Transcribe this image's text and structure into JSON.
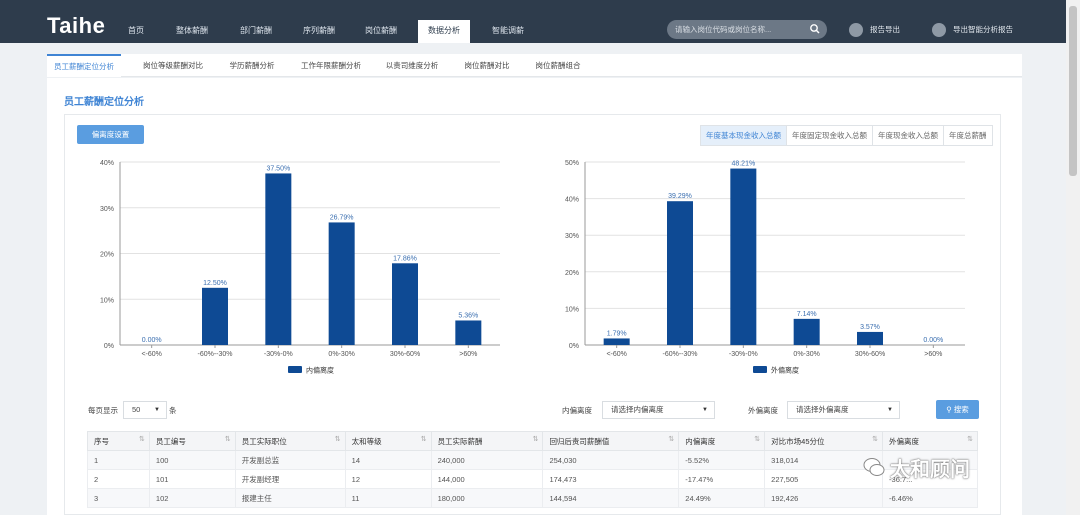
{
  "app": {
    "logo": "Taihe"
  },
  "nav": {
    "items": [
      "首页",
      "整体薪酬",
      "部门薪酬",
      "序列薪酬",
      "岗位薪酬",
      "数据分析",
      "智能调薪"
    ],
    "active_index": 5
  },
  "search": {
    "placeholder": "请输入岗位代码或岗位名称..."
  },
  "tools": {
    "export_report": "报告导出",
    "export_smart": "导出智能分析报告"
  },
  "subtabs": {
    "items": [
      "员工薪酬定位分析",
      "岗位等级薪酬对比",
      "学历薪酬分析",
      "工作年限薪酬分析",
      "以责司维度分析",
      "岗位薪酬对比",
      "岗位薪酬组合"
    ],
    "active_index": 0
  },
  "page": {
    "title": "员工薪酬定位分析"
  },
  "deviation_button": "偏离度设置",
  "basis_tabs": {
    "items": [
      "年度基本现金收入总额",
      "年度固定现金收入总额",
      "年度现金收入总额",
      "年度总薪酬"
    ],
    "active_index": 0
  },
  "chart_data": [
    {
      "type": "bar",
      "categories": [
        "<-60%",
        "-60%--30%",
        "-30%-0%",
        "0%-30%",
        "30%-60%",
        ">60%"
      ],
      "series": [
        {
          "name": "内偏离度",
          "values": [
            0.0,
            12.5,
            37.5,
            26.79,
            17.86,
            5.36
          ]
        }
      ],
      "data_labels": [
        "0.00%",
        "12.50%",
        "37.50%",
        "26.79%",
        "17.86%",
        "5.36%"
      ],
      "yticks": [
        "0%",
        "10%",
        "20%",
        "30%",
        "40%"
      ],
      "ylim": [
        0,
        40
      ],
      "legend": "bottom-center",
      "grid": true,
      "bar_color": "#0e4a94"
    },
    {
      "type": "bar",
      "categories": [
        "<-60%",
        "-60%--30%",
        "-30%-0%",
        "0%-30%",
        "30%-60%",
        ">60%"
      ],
      "series": [
        {
          "name": "外偏离度",
          "values": [
            1.79,
            39.29,
            48.21,
            7.14,
            3.57,
            0.0
          ]
        }
      ],
      "data_labels": [
        "1.79%",
        "39.29%",
        "48.21%",
        "7.14%",
        "3.57%",
        "0.00%"
      ],
      "yticks": [
        "0%",
        "10%",
        "20%",
        "30%",
        "40%",
        "50%"
      ],
      "ylim": [
        0,
        50
      ],
      "legend": "bottom-center",
      "grid": true,
      "bar_color": "#0e4a94"
    }
  ],
  "filters": {
    "page_size_label": "每页显示",
    "page_size_value": "50",
    "page_size_unit": "条",
    "inner_label": "内偏离度",
    "inner_placeholder": "请选择内偏离度",
    "outer_label": "外偏离度",
    "outer_placeholder": "请选择外偏离度",
    "search_button": "搜索"
  },
  "table": {
    "headers": [
      "序号",
      "员工编号",
      "员工实际职位",
      "太和等级",
      "员工实际薪酬",
      "回归后责司薪酬值",
      "内偏离度",
      "对比市场45分位",
      "外偏离度"
    ],
    "rows": [
      [
        "1",
        "100",
        "开发副总监",
        "14",
        "240,000",
        "254,030",
        "-5.52%",
        "318,014",
        ""
      ],
      [
        "2",
        "101",
        "开发副经理",
        "12",
        "144,000",
        "174,473",
        "-17.47%",
        "227,505",
        "-36.7..."
      ],
      [
        "3",
        "102",
        "报建主任",
        "11",
        "180,000",
        "144,594",
        "24.49%",
        "192,426",
        "-6.46%"
      ]
    ]
  },
  "watermark": {
    "text": "太和顾问"
  },
  "colors": {
    "nav_bg": "#2e3c4c",
    "accent": "#3f84d4",
    "bar": "#0e4a94"
  }
}
